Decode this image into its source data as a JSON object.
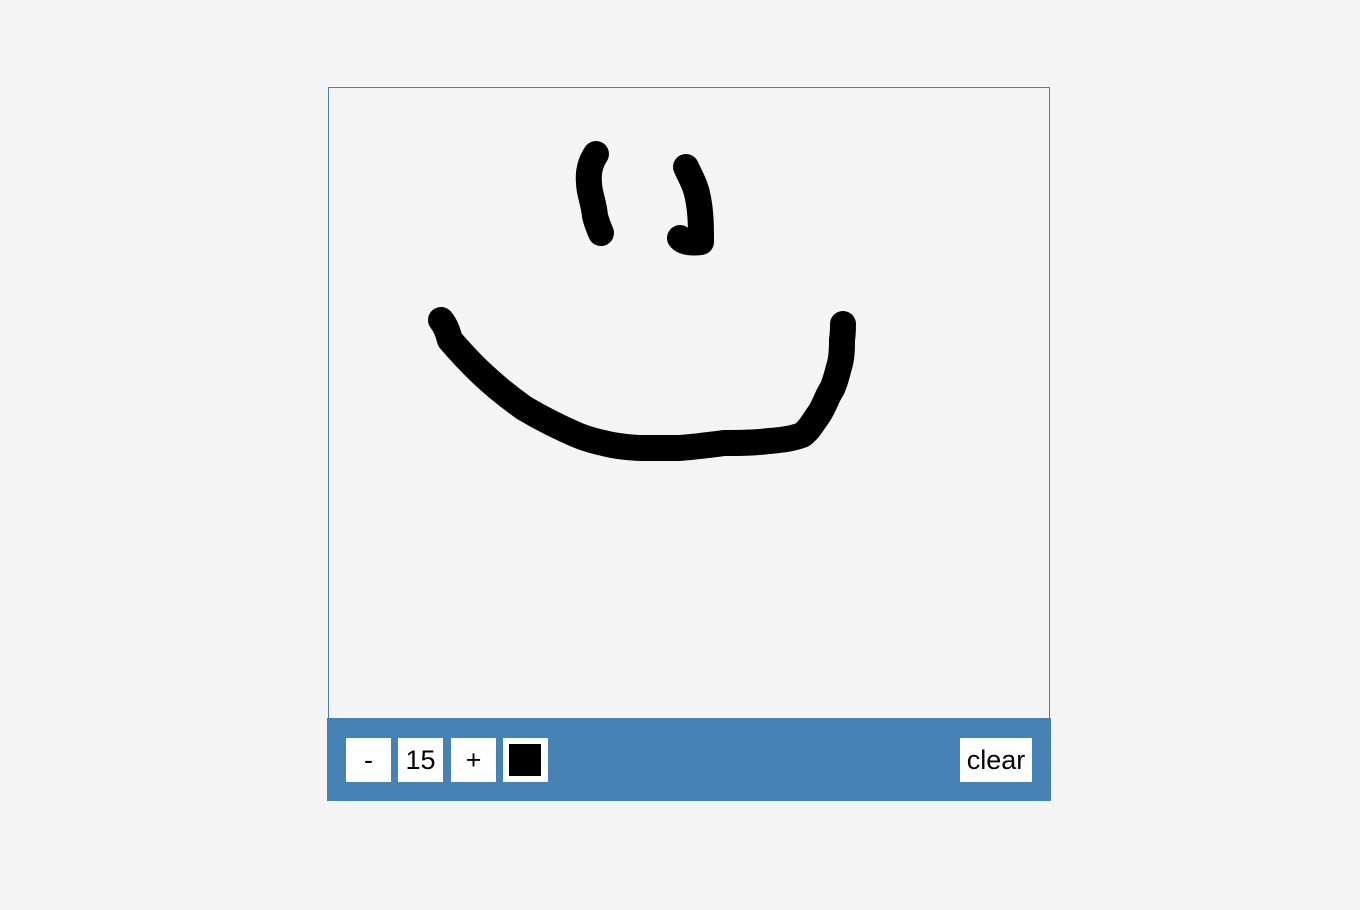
{
  "toolbar": {
    "decrease_label": "-",
    "brush_size": "15",
    "increase_label": "+",
    "clear_label": "clear"
  },
  "brush": {
    "color": "#000000",
    "size": 15
  },
  "colors": {
    "page_background": "#f4f4f4",
    "canvas_background": "#f4f4f4",
    "toolbar_background": "#4682b4",
    "canvas_border": "#4682b4",
    "button_background": "#ffffff",
    "text": "#000000"
  }
}
